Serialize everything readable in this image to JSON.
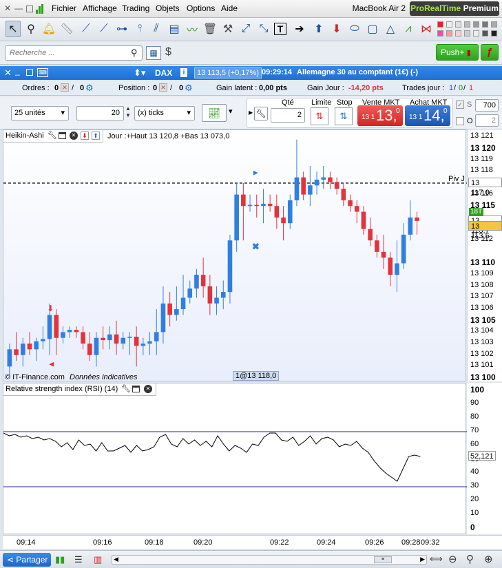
{
  "menubar": {
    "items": [
      "Fichier",
      "Affichage",
      "Trading",
      "Objets",
      "Options",
      "Aide"
    ],
    "computer": "MacBook Air 2",
    "brand_a": "ProRealTime",
    "brand_b": "Premium"
  },
  "search": {
    "placeholder": "Recherche ..."
  },
  "push": {
    "label": "Push+"
  },
  "instrument": {
    "name": "DAX",
    "price": "13 113,5 (+0,17%)",
    "time": "09:29:14",
    "desc": "Allemagne 30 au comptant (1€) (-)"
  },
  "orders": {
    "ordres_label": "Ordres :",
    "ordres_a": "0",
    "ordres_b": "0",
    "position_label": "Position :",
    "position_a": "0",
    "position_b": "0",
    "gain_latent_label": "Gain latent :",
    "gain_latent": "0,00 pts",
    "gain_jour_label": "Gain Jour :",
    "gain_jour": "-14,20 pts",
    "trades_label": "Trades jour :",
    "trades_a": "1",
    "trades_b": "0",
    "trades_c": "1"
  },
  "trade": {
    "units": "25 unités",
    "ticks_value": "20",
    "ticks_label": "(x) ticks",
    "qte_label": "Qté",
    "qte": "2",
    "limite_label": "Limite",
    "stop_label": "Stop",
    "sell_label": "Vente MKT",
    "sell_small": "13 1",
    "sell_big": "13,",
    "sell_frac": "0",
    "buy_label": "Achat MKT",
    "buy_small": "13 1",
    "buy_big": "14,",
    "buy_frac": "0",
    "s_label": "S",
    "s_value": "700",
    "o_label": "O",
    "o_value": "2"
  },
  "chart": {
    "title": "Heikin-Ashi",
    "info": "Jour :+Haut 13 120,8 +Bas 13 073,0",
    "footer_a": "© IT-Finance.com",
    "footer_b": "Données indicatives",
    "cursor_label": "1@13 118,0",
    "piv_label": "Piv J",
    "price_marker": "13 117,0",
    "last_marker": "13 113,7",
    "bid_marker": "13 113,5",
    "tag_18t": "18T"
  },
  "price_axis": [
    {
      "v": "13 121",
      "b": false
    },
    {
      "v": "13 120",
      "b": true
    },
    {
      "v": "13 119",
      "b": false
    },
    {
      "v": "13 118",
      "b": false
    },
    {
      "v": "13 116",
      "b": false
    },
    {
      "v": "13 115",
      "b": true
    },
    {
      "v": "13 112",
      "b": false
    },
    {
      "v": "13 110",
      "b": true
    },
    {
      "v": "13 109",
      "b": false
    },
    {
      "v": "13 108",
      "b": false
    },
    {
      "v": "13 107",
      "b": false
    },
    {
      "v": "13 106",
      "b": false
    },
    {
      "v": "13 105",
      "b": true
    },
    {
      "v": "13 104",
      "b": false
    },
    {
      "v": "13 103",
      "b": false
    },
    {
      "v": "13 102",
      "b": false
    },
    {
      "v": "13 101",
      "b": false
    },
    {
      "v": "13 100",
      "b": true
    }
  ],
  "rsi": {
    "title": "Relative strength index (RSI) (14)",
    "value": "52,121",
    "axis": [
      {
        "v": "100",
        "b": true
      },
      {
        "v": "90",
        "b": false
      },
      {
        "v": "80",
        "b": false
      },
      {
        "v": "70",
        "b": false
      },
      {
        "v": "60",
        "b": false
      },
      {
        "v": "50",
        "b": true
      },
      {
        "v": "40",
        "b": false
      },
      {
        "v": "30",
        "b": false
      },
      {
        "v": "20",
        "b": false
      },
      {
        "v": "10",
        "b": false
      },
      {
        "v": "0",
        "b": true
      }
    ]
  },
  "time_axis": [
    "09:14",
    "09:16",
    "09:18",
    "09:20",
    "09:22",
    "09:24",
    "09:26",
    "09:28",
    "09:32"
  ],
  "bottom": {
    "partager": "Partager"
  },
  "colors": {
    "up": "#2f7fe3",
    "down": "#e2333a",
    "accent": "#1f6fd2"
  },
  "chart_data": {
    "type": "candlestick",
    "candles": [
      [
        13101,
        13103,
        13100,
        13102.5
      ],
      [
        13102.5,
        13104,
        13101.5,
        13102
      ],
      [
        13102,
        13103.5,
        13101,
        13103
      ],
      [
        13103,
        13104,
        13102,
        13102.5
      ],
      [
        13102.5,
        13103.5,
        13101.5,
        13103.2
      ],
      [
        13103.2,
        13104.5,
        13102.5,
        13103.4
      ],
      [
        13103.4,
        13106.5,
        13102,
        13105.5
      ],
      [
        13105.5,
        13106,
        13102,
        13103.5
      ],
      [
        13103.5,
        13104.5,
        13103,
        13104
      ],
      [
        13104,
        13104.5,
        13103.5,
        13104.2
      ],
      [
        13104.2,
        13104.5,
        13103.5,
        13104
      ],
      [
        13104,
        13104.5,
        13102.5,
        13103
      ],
      [
        13103,
        13104,
        13101.5,
        13102
      ],
      [
        13102,
        13104,
        13101,
        13103.5
      ],
      [
        13103.5,
        13104.5,
        13102.5,
        13103.3
      ],
      [
        13103.3,
        13104.5,
        13102.5,
        13103.8
      ],
      [
        13103.8,
        13105,
        13102,
        13103
      ],
      [
        13103,
        13104,
        13102.5,
        13103.5
      ],
      [
        13103.5,
        13104,
        13102,
        13103.6
      ],
      [
        13103.6,
        13104.5,
        13101,
        13102.8
      ],
      [
        13102.8,
        13103.5,
        13102,
        13103
      ],
      [
        13103,
        13104,
        13102,
        13103.2
      ],
      [
        13103.2,
        13106,
        13102,
        13104
      ],
      [
        13104,
        13108,
        13103,
        13106.5
      ],
      [
        13106.5,
        13107.5,
        13104.5,
        13105.5
      ],
      [
        13105.5,
        13108,
        13105,
        13106
      ],
      [
        13106,
        13109,
        13105.5,
        13107
      ],
      [
        13107,
        13108.5,
        13106.5,
        13107.8
      ],
      [
        13107.8,
        13109.5,
        13107,
        13109
      ],
      [
        13109,
        13110.5,
        13107,
        13108
      ],
      [
        13108,
        13109,
        13105.5,
        13106.5
      ],
      [
        13106.5,
        13108,
        13105.5,
        13107
      ],
      [
        13107,
        13108.5,
        13106,
        13107.5
      ],
      [
        13107.5,
        13112.5,
        13106.5,
        13112
      ],
      [
        13112,
        13117,
        13111,
        13116
      ],
      [
        13116,
        13117,
        13112,
        13115
      ],
      [
        13115,
        13116,
        13114.5,
        13115.1
      ],
      [
        13115.1,
        13116,
        13114,
        13115
      ],
      [
        13115,
        13116.5,
        13113.5,
        13115.2
      ],
      [
        13115.2,
        13116,
        13114.5,
        13115
      ],
      [
        13115,
        13116,
        13113,
        13114
      ],
      [
        13114,
        13115,
        13112,
        13113.5
      ],
      [
        13113.5,
        13116,
        13113,
        13115.5
      ],
      [
        13115.5,
        13120.8,
        13115,
        13117.5
      ],
      [
        13117.5,
        13118,
        13115.5,
        13116
      ],
      [
        13116,
        13118.5,
        13115,
        13116.8
      ],
      [
        13116.8,
        13118,
        13116,
        13117.3
      ],
      [
        13117.3,
        13118.5,
        13116.5,
        13117.5
      ],
      [
        13117.5,
        13118,
        13116.5,
        13117.1
      ],
      [
        13117.1,
        13117.5,
        13116,
        13116.5
      ],
      [
        13116.5,
        13117,
        13115,
        13115.5
      ],
      [
        13115.5,
        13116,
        13114.5,
        13115
      ],
      [
        13115,
        13115.5,
        13113.5,
        13114.5
      ],
      [
        13114.5,
        13115,
        13112.5,
        13113
      ],
      [
        13113,
        13114,
        13111.5,
        13112
      ],
      [
        13112,
        13112.5,
        13110.5,
        13111
      ],
      [
        13111,
        13112.5,
        13109.5,
        13110.5
      ],
      [
        13110.5,
        13111,
        13108,
        13109
      ],
      [
        13109,
        13112,
        13107.5,
        13110
      ],
      [
        13110,
        13113.5,
        13109.5,
        13112.5
      ],
      [
        13112.5,
        13115.5,
        13112,
        13114
      ],
      [
        13114,
        13114.5,
        13112.5,
        13113.7
      ]
    ],
    "pivot": 13117,
    "rsi": [
      69,
      67,
      68,
      66,
      67,
      65,
      66,
      64,
      65,
      63,
      59,
      62,
      57,
      64,
      60,
      61,
      56,
      62,
      56,
      56,
      58,
      60,
      55,
      60,
      56,
      57,
      59,
      66,
      68,
      61,
      59,
      65,
      61,
      64,
      60,
      63,
      59,
      67,
      61,
      56,
      60,
      58,
      55,
      61,
      60,
      66,
      69,
      69,
      64,
      63,
      66,
      60,
      63,
      67,
      61,
      65,
      66,
      64,
      59,
      61,
      60,
      63,
      58,
      55,
      49,
      44,
      40,
      37,
      34,
      43,
      52,
      53,
      52
    ],
    "rsi_levels": [
      70,
      30
    ],
    "rsi_range": [
      0,
      100
    ],
    "price_range": [
      13100,
      13121.5
    ]
  }
}
